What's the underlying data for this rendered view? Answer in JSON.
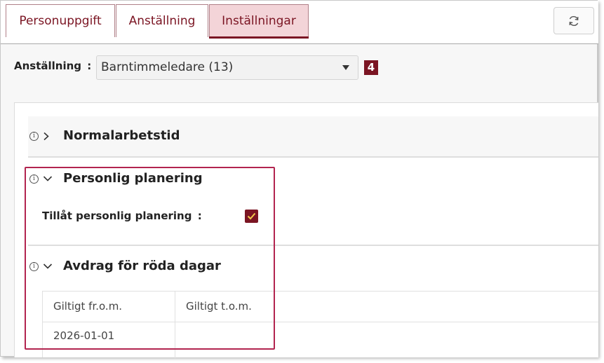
{
  "tabs": [
    {
      "label": "Personuppgift",
      "active": false
    },
    {
      "label": "Anställning",
      "active": false
    },
    {
      "label": "Inställningar",
      "active": true
    }
  ],
  "toolbar": {
    "refresh_icon": "refresh-icon"
  },
  "employment": {
    "label": "Anställning",
    "colon": ":",
    "selected": "Barntimmeledare (13)",
    "count_badge": "4"
  },
  "sections": {
    "normal": {
      "title": "Normalarbetstid",
      "expanded": false
    },
    "personal": {
      "title": "Personlig planering",
      "expanded": true,
      "setting_label": "Tillåt personlig planering",
      "setting_colon": ":",
      "setting_checked": true
    },
    "red_days": {
      "title": "Avdrag för röda dagar",
      "expanded": true,
      "columns": [
        "Giltigt fr.o.m.",
        "Giltigt t.o.m."
      ],
      "rows": [
        [
          "2026-01-01",
          ""
        ]
      ]
    }
  },
  "colors": {
    "accent": "#7b1523",
    "tab_active_bg": "#f3d4d8",
    "highlight": "#b2244f"
  }
}
